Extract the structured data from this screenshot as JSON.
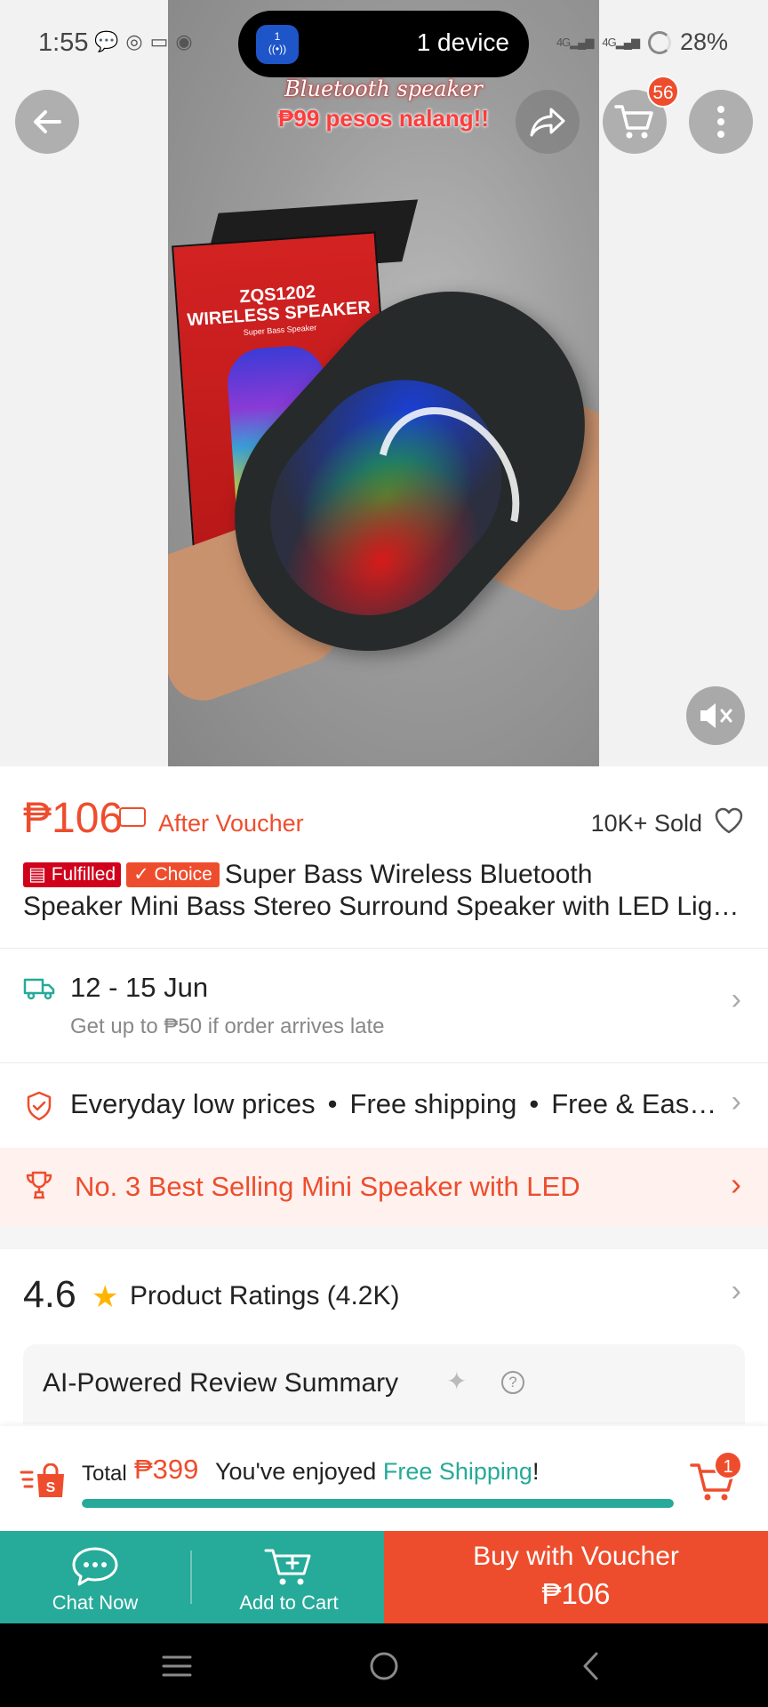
{
  "status_bar": {
    "time": "1:55",
    "device_pill": "1 device",
    "island_dot": "1",
    "battery": "28%",
    "network_1": "4G",
    "network_2": "4G"
  },
  "media": {
    "caption_line1": "Bluetooth speaker",
    "caption_line2": "₱99 pesos nalang!!",
    "box_title_1": "ZQS1202",
    "box_title_2": "WIRELESS SPEAKER",
    "box_subtitle": "Super Bass Speaker",
    "cart_badge": "56"
  },
  "product": {
    "price": "₱106",
    "after_voucher": "After Voucher",
    "sold": "10K+ Sold",
    "tag_fulfilled": "Fulfilled",
    "tag_choice": "✓ Choice",
    "title_line1": "Super Bass Wireless Bluetooth",
    "title_line2": "Speaker Mini Bass Stereo Surround Speaker with LED Lights"
  },
  "shipping": {
    "date": "12 - 15 Jun",
    "note": "Get up to ₱50 if order arrives late"
  },
  "benefits": {
    "item1": "Everyday low prices",
    "item2": "Free shipping",
    "item3": "Free & Easy Returns"
  },
  "best_seller": {
    "text": "No. 3 Best Selling Mini Speaker with LED"
  },
  "ratings": {
    "score": "4.6",
    "label": "Product Ratings (4.2K)"
  },
  "ai_summary": {
    "title": "AI-Powered Review Summary"
  },
  "cart_summary": {
    "total_label": "Total",
    "total_price": "₱399",
    "enjoyed_prefix": "You've enjoyed",
    "free_shipping": "Free Shipping",
    "enjoyed_suffix": "!",
    "progress": 1.0,
    "cart_count": "1"
  },
  "actions": {
    "chat": "Chat Now",
    "add_to_cart": "Add to Cart",
    "buy_line1": "Buy with Voucher",
    "buy_line2": "₱106"
  },
  "colors": {
    "brand": "#ee4d2d",
    "teal": "#26aa99",
    "fulfilled": "#d0011b",
    "star": "#ffb400"
  },
  "icons": [
    "back-arrow-icon",
    "share-icon",
    "cart-icon",
    "more-vertical-icon",
    "mute-icon",
    "voucher-icon",
    "heart-icon",
    "truck-icon",
    "shield-check-icon",
    "trophy-icon",
    "star-icon",
    "sparkle-icon",
    "help-icon",
    "shopping-bag-icon",
    "chat-icon",
    "add-cart-icon",
    "menu-icon",
    "home-circle-icon",
    "back-nav-icon"
  ]
}
